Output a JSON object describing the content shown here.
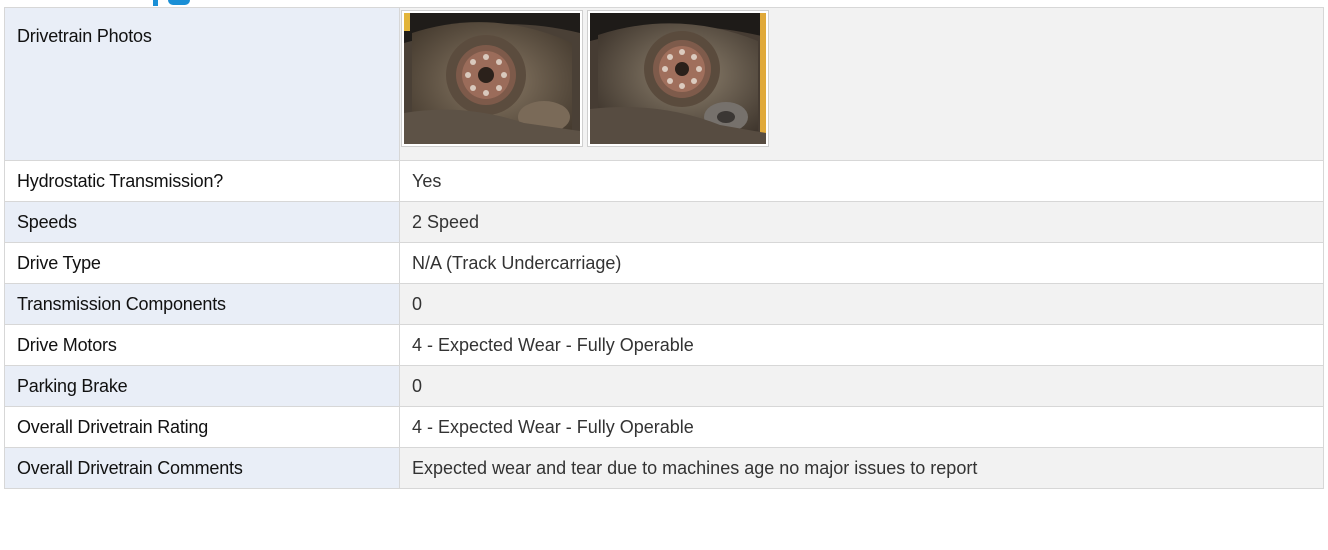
{
  "section": {
    "accent_color": "#1a8fd6"
  },
  "drivetrain_photos": {
    "label": "Drivetrain Photos",
    "photos": [
      {
        "icon": "drive-sprocket-photo"
      },
      {
        "icon": "drive-sprocket-photo"
      }
    ]
  },
  "rows": [
    {
      "label": "Hydrostatic Transmission?",
      "value": "Yes"
    },
    {
      "label": "Speeds",
      "value": "2 Speed"
    },
    {
      "label": "Drive Type",
      "value": "N/A (Track Undercarriage)"
    },
    {
      "label": "Transmission Components",
      "value": "0"
    },
    {
      "label": "Drive Motors",
      "value": "4 - Expected Wear - Fully Operable"
    },
    {
      "label": "Parking Brake",
      "value": "0"
    },
    {
      "label": "Overall Drivetrain Rating",
      "value": "4 - Expected Wear - Fully Operable"
    },
    {
      "label": "Overall Drivetrain Comments",
      "value": "Expected wear and tear due to machines age no major issues to report"
    }
  ],
  "colors": {
    "label_bg": "#e9eef7",
    "value_bg": "#f2f2f2",
    "border": "#d7d7d7"
  }
}
